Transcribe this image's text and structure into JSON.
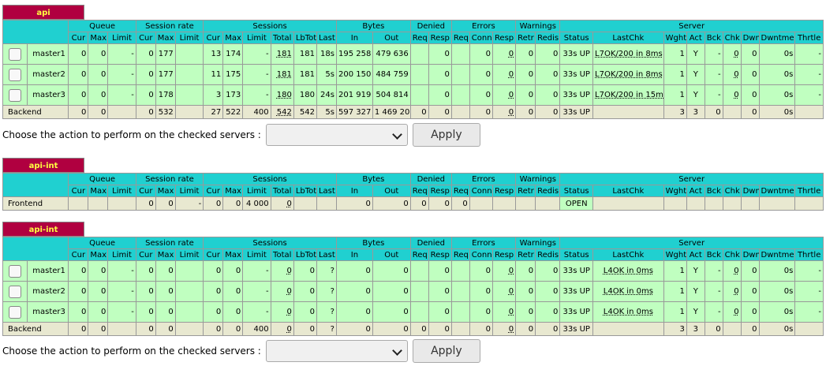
{
  "proxy1": {
    "name": "api",
    "groups": [
      "Queue",
      "Session rate",
      "Sessions",
      "Bytes",
      "Denied",
      "Errors",
      "Warnings",
      "Server"
    ],
    "cols": [
      "Cur",
      "Max",
      "Limit",
      "Cur",
      "Max",
      "Limit",
      "Cur",
      "Max",
      "Limit",
      "Total",
      "LbTot",
      "Last",
      "In",
      "Out",
      "Req",
      "Resp",
      "Req",
      "Conn",
      "Resp",
      "Retr",
      "Redis",
      "Status",
      "LastChk",
      "Wght",
      "Act",
      "Bck",
      "Chk",
      "Dwn",
      "Dwntme",
      "Thrtle"
    ],
    "rows": [
      {
        "name": "master1",
        "v": [
          "0",
          "0",
          "-",
          "0",
          "177",
          "",
          "13",
          "174",
          "-",
          "181",
          "181",
          "18s",
          "195 258",
          "479 636",
          "",
          "0",
          "",
          "0",
          "0",
          "0",
          "0",
          "33s UP",
          "L7OK/200 in 8ms",
          "1",
          "Y",
          "-",
          "0",
          "0",
          "0s",
          "-"
        ]
      },
      {
        "name": "master2",
        "v": [
          "0",
          "0",
          "-",
          "0",
          "177",
          "",
          "11",
          "175",
          "-",
          "181",
          "181",
          "5s",
          "200 150",
          "484 759",
          "",
          "0",
          "",
          "0",
          "0",
          "0",
          "0",
          "33s UP",
          "L7OK/200 in 8ms",
          "1",
          "Y",
          "-",
          "0",
          "0",
          "0s",
          "-"
        ]
      },
      {
        "name": "master3",
        "v": [
          "0",
          "0",
          "-",
          "0",
          "178",
          "",
          "3",
          "173",
          "-",
          "180",
          "180",
          "24s",
          "201 919",
          "504 814",
          "",
          "0",
          "",
          "0",
          "0",
          "0",
          "0",
          "33s UP",
          "L7OK/200 in 15ms",
          "1",
          "Y",
          "-",
          "0",
          "0",
          "0s",
          "-"
        ]
      }
    ],
    "backend": {
      "name": "Backend",
      "v": [
        "0",
        "0",
        "",
        "0",
        "532",
        "",
        "27",
        "522",
        "400",
        "542",
        "542",
        "5s",
        "597 327",
        "1 469 209",
        "0",
        "0",
        "",
        "0",
        "0",
        "0",
        "0",
        "33s UP",
        "",
        "3",
        "3",
        "0",
        "",
        "0",
        "0s",
        ""
      ]
    }
  },
  "action1": {
    "label": "Choose the action to perform on the checked servers :",
    "apply": "Apply"
  },
  "proxy2": {
    "name": "api-int",
    "groups": [
      "Queue",
      "Session rate",
      "Sessions",
      "Bytes",
      "Denied",
      "Errors",
      "Warnings",
      "Server"
    ],
    "cols": [
      "Cur",
      "Max",
      "Limit",
      "Cur",
      "Max",
      "Limit",
      "Cur",
      "Max",
      "Limit",
      "Total",
      "LbTot",
      "Last",
      "In",
      "Out",
      "Req",
      "Resp",
      "Req",
      "Conn",
      "Resp",
      "Retr",
      "Redis",
      "Status",
      "LastChk",
      "Wght",
      "Act",
      "Bck",
      "Chk",
      "Dwn",
      "Dwntme",
      "Thrtle"
    ],
    "frontend": {
      "name": "Frontend",
      "v": [
        "",
        "",
        "",
        "0",
        "0",
        "-",
        "0",
        "0",
        "4 000",
        "0",
        "",
        "",
        "0",
        "0",
        "0",
        "0",
        "0",
        "",
        "",
        "",
        "",
        "OPEN",
        "",
        "",
        "",
        "",
        "",
        "",
        "",
        ""
      ]
    }
  },
  "proxy3": {
    "name": "api-int",
    "groups": [
      "Queue",
      "Session rate",
      "Sessions",
      "Bytes",
      "Denied",
      "Errors",
      "Warnings",
      "Server"
    ],
    "cols": [
      "Cur",
      "Max",
      "Limit",
      "Cur",
      "Max",
      "Limit",
      "Cur",
      "Max",
      "Limit",
      "Total",
      "LbTot",
      "Last",
      "In",
      "Out",
      "Req",
      "Resp",
      "Req",
      "Conn",
      "Resp",
      "Retr",
      "Redis",
      "Status",
      "LastChk",
      "Wght",
      "Act",
      "Bck",
      "Chk",
      "Dwn",
      "Dwntme",
      "Thrtle"
    ],
    "rows": [
      {
        "name": "master1",
        "v": [
          "0",
          "0",
          "-",
          "0",
          "0",
          "",
          "0",
          "0",
          "-",
          "0",
          "0",
          "?",
          "0",
          "0",
          "",
          "0",
          "",
          "0",
          "0",
          "0",
          "0",
          "33s UP",
          "L4OK in 0ms",
          "1",
          "Y",
          "-",
          "0",
          "0",
          "0s",
          "-"
        ]
      },
      {
        "name": "master2",
        "v": [
          "0",
          "0",
          "-",
          "0",
          "0",
          "",
          "0",
          "0",
          "-",
          "0",
          "0",
          "?",
          "0",
          "0",
          "",
          "0",
          "",
          "0",
          "0",
          "0",
          "0",
          "33s UP",
          "L4OK in 0ms",
          "1",
          "Y",
          "-",
          "0",
          "0",
          "0s",
          "-"
        ]
      },
      {
        "name": "master3",
        "v": [
          "0",
          "0",
          "-",
          "0",
          "0",
          "",
          "0",
          "0",
          "-",
          "0",
          "0",
          "?",
          "0",
          "0",
          "",
          "0",
          "",
          "0",
          "0",
          "0",
          "0",
          "33s UP",
          "L4OK in 0ms",
          "1",
          "Y",
          "-",
          "0",
          "0",
          "0s",
          "-"
        ]
      }
    ],
    "backend": {
      "name": "Backend",
      "v": [
        "0",
        "0",
        "",
        "0",
        "0",
        "",
        "0",
        "0",
        "400",
        "0",
        "0",
        "?",
        "0",
        "0",
        "0",
        "0",
        "",
        "0",
        "0",
        "0",
        "0",
        "33s UP",
        "",
        "3",
        "3",
        "0",
        "",
        "0",
        "0s",
        ""
      ]
    }
  },
  "action2": {
    "label": "Choose the action to perform on the checked servers :",
    "apply": "Apply"
  }
}
